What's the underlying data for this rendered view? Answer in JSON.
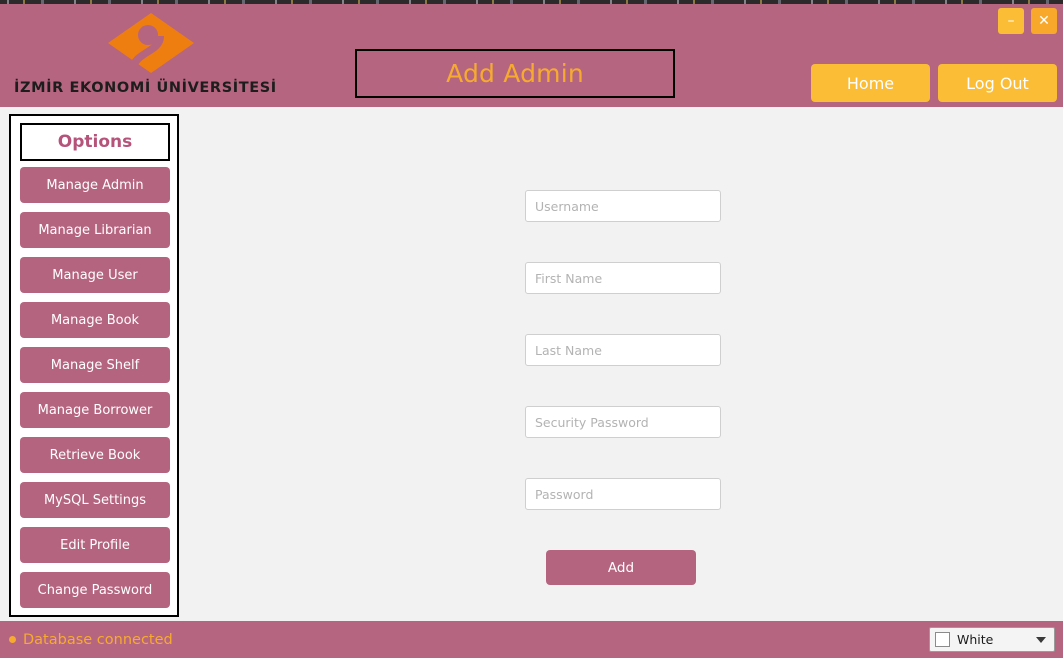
{
  "window": {
    "minimize_label": "–",
    "close_label": "✕"
  },
  "header": {
    "logo_text": "İZMİR EKONOMİ ÜNİVERSİTESİ",
    "logo_icon": "university-diamond-logo",
    "page_title": "Add Admin",
    "home_label": "Home",
    "logout_label": "Log Out",
    "background_color": "#b5657f",
    "accent_color": "#fbbc36",
    "title_text_color": "#f6ab2f"
  },
  "sidebar": {
    "heading": "Options",
    "heading_color": "#b5537a",
    "button_color": "#b5647f",
    "items": [
      {
        "label": "Manage Admin"
      },
      {
        "label": "Manage Librarian"
      },
      {
        "label": "Manage User"
      },
      {
        "label": "Manage Book"
      },
      {
        "label": "Manage Shelf"
      },
      {
        "label": "Manage Borrower"
      },
      {
        "label": "Retrieve Book"
      },
      {
        "label": "MySQL Settings"
      },
      {
        "label": "Edit Profile"
      },
      {
        "label": "Change Password"
      }
    ]
  },
  "form": {
    "fields": [
      {
        "name": "username",
        "placeholder": "Username",
        "value": ""
      },
      {
        "name": "first_name",
        "placeholder": "First Name",
        "value": ""
      },
      {
        "name": "last_name",
        "placeholder": "Last Name",
        "value": ""
      },
      {
        "name": "security_password",
        "placeholder": "Security Password",
        "value": ""
      },
      {
        "name": "password",
        "placeholder": "Password",
        "value": ""
      }
    ],
    "submit_label": "Add"
  },
  "statusbar": {
    "db_status": "Database connected",
    "db_status_color": "#f6ab2f",
    "theme_selected": "White",
    "theme_swatch_color": "#ffffff",
    "caret_icon": "chevron-down-icon"
  }
}
